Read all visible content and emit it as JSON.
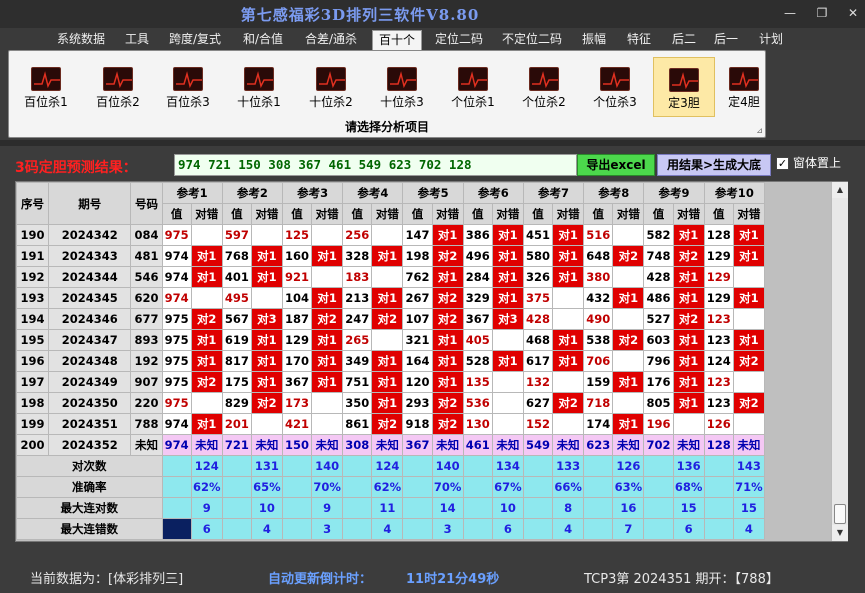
{
  "window": {
    "title": "第七感福彩3D排列三软件V8.80",
    "controls": [
      "—",
      "❐",
      "✕"
    ]
  },
  "menu": [
    "系统数据",
    "工具",
    "跨度/复式",
    "和/合值",
    "合差/通杀",
    "百十个",
    "定位二码",
    "不定位二码",
    "振幅",
    "特征",
    "后二",
    "后一",
    "计划"
  ],
  "menu_active": "百十个",
  "ribbon": {
    "tools": [
      "百位杀1",
      "百位杀2",
      "百位杀3",
      "十位杀1",
      "十位杀2",
      "十位杀3",
      "个位杀1",
      "个位杀2",
      "个位杀3",
      "定3胆",
      "定4胆"
    ],
    "selected": "定3胆",
    "caption": "请选择分析项目",
    "expand_icon": "⊿"
  },
  "prediction": {
    "label": "3码定胆预测结果：",
    "value": "974  721  150  308  367  461  549  623  702  128",
    "excel_button": "导出excel",
    "generate_button": "用结果>生成大底",
    "topmost_label": "窗体置上",
    "topmost_checked": "✓"
  },
  "table": {
    "headers": {
      "seq": "序号",
      "period": "期号",
      "number": "号码",
      "value": "值",
      "result": "对错"
    },
    "refs": [
      "参考1",
      "参考2",
      "参考3",
      "参考4",
      "参考5",
      "参考6",
      "参考7",
      "参考8",
      "参考9",
      "参考10"
    ],
    "rows": [
      {
        "seq": "190",
        "period": "2024342",
        "number": "084",
        "cells": [
          [
            "975",
            "",
            "r"
          ],
          [
            "597",
            "",
            "r"
          ],
          [
            "125",
            "",
            "r"
          ],
          [
            "256",
            "",
            "r"
          ],
          [
            "147",
            "对1",
            ""
          ],
          [
            "386",
            "对1",
            ""
          ],
          [
            "451",
            "对1",
            ""
          ],
          [
            "516",
            "",
            "r"
          ],
          [
            "582",
            "对1",
            ""
          ],
          [
            "128",
            "对1",
            ""
          ]
        ]
      },
      {
        "seq": "191",
        "period": "2024343",
        "number": "481",
        "cells": [
          [
            "974",
            "对1",
            ""
          ],
          [
            "768",
            "对1",
            ""
          ],
          [
            "160",
            "对1",
            ""
          ],
          [
            "328",
            "对1",
            ""
          ],
          [
            "198",
            "对2",
            ""
          ],
          [
            "496",
            "对1",
            ""
          ],
          [
            "580",
            "对1",
            ""
          ],
          [
            "648",
            "对2",
            ""
          ],
          [
            "748",
            "对2",
            ""
          ],
          [
            "129",
            "对1",
            ""
          ]
        ]
      },
      {
        "seq": "192",
        "period": "2024344",
        "number": "546",
        "cells": [
          [
            "974",
            "对1",
            ""
          ],
          [
            "401",
            "对1",
            ""
          ],
          [
            "921",
            "",
            "r"
          ],
          [
            "183",
            "",
            "r"
          ],
          [
            "762",
            "对1",
            ""
          ],
          [
            "284",
            "对1",
            ""
          ],
          [
            "326",
            "对1",
            ""
          ],
          [
            "380",
            "",
            "r"
          ],
          [
            "428",
            "对1",
            ""
          ],
          [
            "129",
            "",
            "r"
          ]
        ]
      },
      {
        "seq": "193",
        "period": "2024345",
        "number": "620",
        "cells": [
          [
            "974",
            "",
            "r"
          ],
          [
            "495",
            "",
            "r"
          ],
          [
            "104",
            "对1",
            ""
          ],
          [
            "213",
            "对1",
            ""
          ],
          [
            "267",
            "对2",
            ""
          ],
          [
            "329",
            "对1",
            ""
          ],
          [
            "375",
            "",
            "r"
          ],
          [
            "432",
            "对1",
            ""
          ],
          [
            "486",
            "对1",
            ""
          ],
          [
            "129",
            "对1",
            ""
          ]
        ]
      },
      {
        "seq": "194",
        "period": "2024346",
        "number": "677",
        "cells": [
          [
            "975",
            "对2",
            ""
          ],
          [
            "567",
            "对3",
            ""
          ],
          [
            "187",
            "对2",
            ""
          ],
          [
            "247",
            "对2",
            ""
          ],
          [
            "107",
            "对2",
            ""
          ],
          [
            "367",
            "对3",
            ""
          ],
          [
            "428",
            "",
            "r"
          ],
          [
            "490",
            "",
            "r"
          ],
          [
            "527",
            "对2",
            ""
          ],
          [
            "123",
            "",
            "r"
          ]
        ]
      },
      {
        "seq": "195",
        "period": "2024347",
        "number": "893",
        "cells": [
          [
            "975",
            "对1",
            ""
          ],
          [
            "619",
            "对1",
            ""
          ],
          [
            "129",
            "对1",
            ""
          ],
          [
            "265",
            "",
            "r"
          ],
          [
            "321",
            "对1",
            ""
          ],
          [
            "405",
            "",
            "r"
          ],
          [
            "468",
            "对1",
            ""
          ],
          [
            "538",
            "对2",
            ""
          ],
          [
            "603",
            "对1",
            ""
          ],
          [
            "123",
            "对1",
            ""
          ]
        ]
      },
      {
        "seq": "196",
        "period": "2024348",
        "number": "192",
        "cells": [
          [
            "975",
            "对1",
            ""
          ],
          [
            "817",
            "对1",
            ""
          ],
          [
            "170",
            "对1",
            ""
          ],
          [
            "349",
            "对1",
            ""
          ],
          [
            "164",
            "对1",
            ""
          ],
          [
            "528",
            "对1",
            ""
          ],
          [
            "617",
            "对1",
            ""
          ],
          [
            "706",
            "",
            "r"
          ],
          [
            "796",
            "对1",
            ""
          ],
          [
            "124",
            "对2",
            ""
          ]
        ]
      },
      {
        "seq": "197",
        "period": "2024349",
        "number": "907",
        "cells": [
          [
            "975",
            "对2",
            ""
          ],
          [
            "175",
            "对1",
            ""
          ],
          [
            "367",
            "对1",
            ""
          ],
          [
            "751",
            "对1",
            ""
          ],
          [
            "120",
            "对1",
            ""
          ],
          [
            "135",
            "",
            "r"
          ],
          [
            "132",
            "",
            "r"
          ],
          [
            "159",
            "对1",
            ""
          ],
          [
            "176",
            "对1",
            ""
          ],
          [
            "123",
            "",
            "r"
          ]
        ]
      },
      {
        "seq": "198",
        "period": "2024350",
        "number": "220",
        "cells": [
          [
            "975",
            "",
            "r"
          ],
          [
            "829",
            "对2",
            ""
          ],
          [
            "173",
            "",
            "r"
          ],
          [
            "350",
            "对1",
            ""
          ],
          [
            "293",
            "对2",
            ""
          ],
          [
            "536",
            "",
            "r"
          ],
          [
            "627",
            "对2",
            ""
          ],
          [
            "718",
            "",
            "r"
          ],
          [
            "805",
            "对1",
            ""
          ],
          [
            "123",
            "对2",
            ""
          ]
        ]
      },
      {
        "seq": "199",
        "period": "2024351",
        "number": "788",
        "cells": [
          [
            "974",
            "对1",
            ""
          ],
          [
            "201",
            "",
            "r"
          ],
          [
            "421",
            "",
            "r"
          ],
          [
            "861",
            "对2",
            ""
          ],
          [
            "918",
            "对2",
            ""
          ],
          [
            "130",
            "",
            "r"
          ],
          [
            "152",
            "",
            "r"
          ],
          [
            "174",
            "对1",
            ""
          ],
          [
            "196",
            "",
            "r"
          ],
          [
            "126",
            "",
            "r"
          ]
        ]
      }
    ],
    "unknown_row": {
      "seq": "200",
      "period": "2024352",
      "number": "未知",
      "values": [
        "974",
        "721",
        "150",
        "308",
        "367",
        "461",
        "549",
        "623",
        "702",
        "128"
      ],
      "result": "未知"
    },
    "stats": [
      {
        "label": "对次数",
        "values": [
          "124",
          "131",
          "140",
          "124",
          "140",
          "134",
          "133",
          "126",
          "136",
          "143"
        ]
      },
      {
        "label": "准确率",
        "values": [
          "62%",
          "65%",
          "70%",
          "62%",
          "70%",
          "67%",
          "66%",
          "63%",
          "68%",
          "71%"
        ]
      },
      {
        "label": "最大连对数",
        "values": [
          "9",
          "10",
          "9",
          "11",
          "14",
          "10",
          "8",
          "16",
          "15",
          "15"
        ]
      },
      {
        "label": "最大连错数",
        "values": [
          "6",
          "4",
          "3",
          "4",
          "3",
          "6",
          "4",
          "7",
          "6",
          "4"
        ]
      }
    ]
  },
  "status": {
    "data_source": "当前数据为：[体彩排列三]",
    "countdown_label": "自动更新倒计时：",
    "countdown_value": "11时21分49秒",
    "latest": "TCP3第 2024351 期开：【788】"
  },
  "colors": {
    "hit": "#e00000",
    "miss_value": "#c00000",
    "stat_bg": "#8ee8ee",
    "unknown_bg": "#f4c8f4",
    "title": "#7b9bf0"
  }
}
